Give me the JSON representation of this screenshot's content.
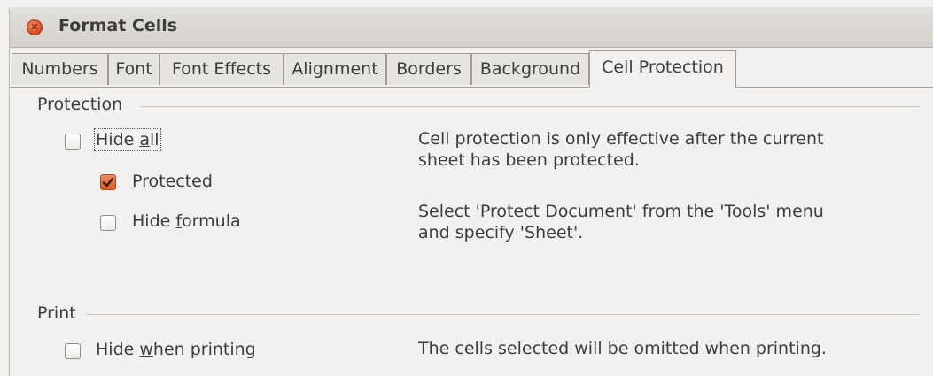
{
  "window": {
    "title": "Format Cells",
    "close_icon": "close-icon"
  },
  "tabs": [
    {
      "label": "Numbers"
    },
    {
      "label": "Font"
    },
    {
      "label": "Font Effects"
    },
    {
      "label": "Alignment"
    },
    {
      "label": "Borders"
    },
    {
      "label": "Background"
    },
    {
      "label": "Cell Protection",
      "active": true
    }
  ],
  "protection": {
    "title": "Protection",
    "hide_all": {
      "pre": "Hide ",
      "mn": "a",
      "post": "ll",
      "checked": false
    },
    "protected": {
      "pre": "",
      "mn": "P",
      "post": "rotected",
      "checked": true
    },
    "hide_formula": {
      "pre": "Hide ",
      "mn": "f",
      "post": "ormula",
      "checked": false
    },
    "info_line1": "Cell protection is only effective after the current",
    "info_line2": "sheet has been protected.",
    "info_line3": "Select 'Protect Document' from the 'Tools' menu",
    "info_line4": "and specify 'Sheet'."
  },
  "print": {
    "title": "Print",
    "hide_when_printing": {
      "pre": "Hide ",
      "mn": "w",
      "post": "hen printing",
      "checked": false
    },
    "info": "The cells selected will be omitted when printing."
  },
  "colors": {
    "accent": "#df5a26",
    "background": "#f2f1f0"
  }
}
